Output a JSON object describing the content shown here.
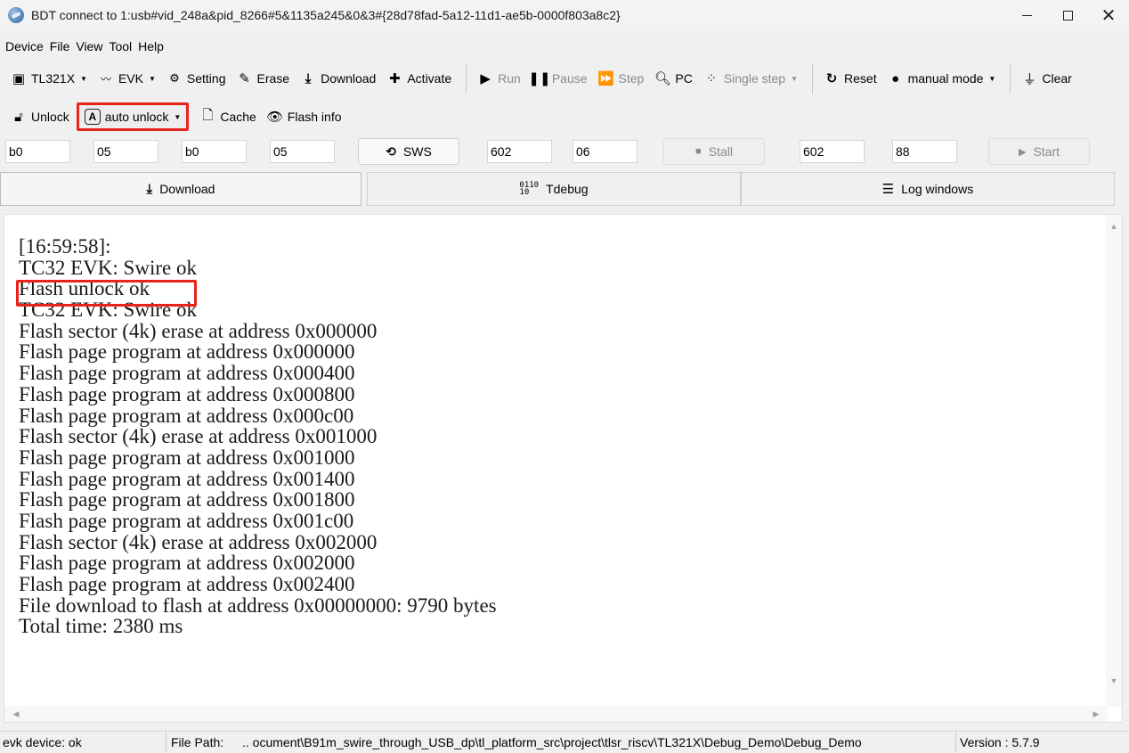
{
  "window": {
    "title": "BDT connect to 1:usb#vid_248a&pid_8266#5&1135a245&0&3#{28d78fad-5a12-11d1-ae5b-0000f803a8c2}"
  },
  "menu": [
    "Device",
    "File",
    "View",
    "Tool",
    "Help"
  ],
  "toolbar1": {
    "chip": "TL321X",
    "evk": "EVK",
    "setting": "Setting",
    "erase": "Erase",
    "download": "Download",
    "activate": "Activate",
    "run": "Run",
    "pause": "Pause",
    "step": "Step",
    "pc": "PC",
    "single_step": "Single step",
    "reset": "Reset",
    "mode": "manual mode",
    "clear": "Clear"
  },
  "toolbar2": {
    "unlock": "Unlock",
    "unlock_mode": "auto unlock",
    "cache": "Cache",
    "flash_info": "Flash info"
  },
  "params": {
    "f1": "b0",
    "f2": "05",
    "f3": "b0",
    "f4": "05",
    "sws": "SWS",
    "f5": "602",
    "f6": "06",
    "stall": "Stall",
    "f7": "602",
    "f8": "88",
    "start": "Start"
  },
  "tabs": [
    "Download",
    "Tdebug",
    "Log windows"
  ],
  "log": [
    "[16:59:58]:",
    "TC32 EVK: Swire ok",
    "Flash unlock ok",
    "TC32 EVK: Swire ok",
    "Flash sector (4k) erase at address 0x000000",
    "Flash page program at address 0x000000",
    "Flash page program at address 0x000400",
    "Flash page program at address 0x000800",
    "Flash page program at address 0x000c00",
    "Flash sector (4k) erase at address 0x001000",
    "Flash page program at address 0x001000",
    "Flash page program at address 0x001400",
    "Flash page program at address 0x001800",
    "Flash page program at address 0x001c00",
    "Flash sector (4k) erase at address 0x002000",
    "Flash page program at address 0x002000",
    "Flash page program at address 0x002400",
    "File download to flash at address 0x00000000: 9790 bytes",
    "Total time: 2380 ms"
  ],
  "status": {
    "device": "evk device: ok",
    "file_path_label": "File Path:",
    "file_path": "..  ocument\\B91m_swire_through_USB_dp\\tl_platform_src\\project\\tlsr_riscv\\TL321X\\Debug_Demo\\Debug_Demo",
    "version": "Version : 5.7.9"
  },
  "colors": {
    "highlight": "#e8231c"
  }
}
